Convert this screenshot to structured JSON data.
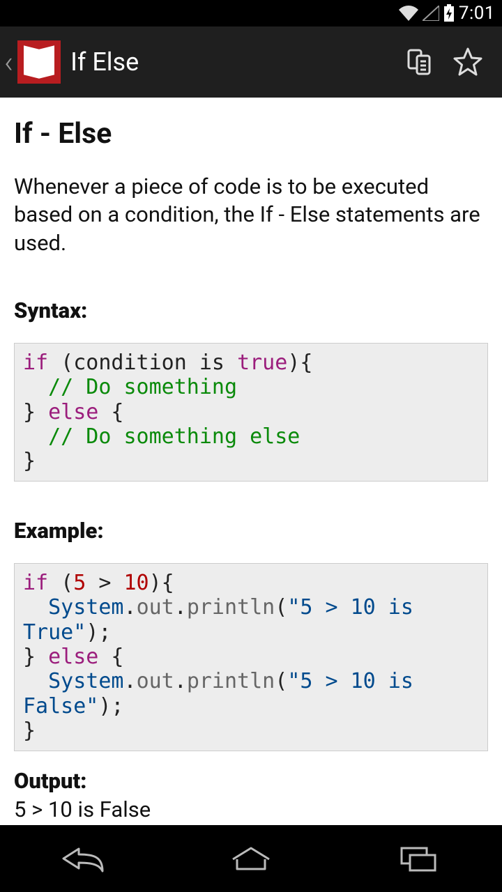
{
  "status": {
    "time": "7:01"
  },
  "appbar": {
    "title": "If Else"
  },
  "content": {
    "heading": "If - Else",
    "description": "Whenever a piece of code is to be executed based on a condition, the If - Else statements are used.",
    "syntax_label": "Syntax:",
    "example_label": "Example:",
    "output_label": "Output:",
    "output_text": "5 > 10 is False"
  },
  "code": {
    "syntax": {
      "tokens": [
        {
          "t": "kw",
          "v": "if"
        },
        {
          "t": "",
          "v": " (condition is "
        },
        {
          "t": "kw",
          "v": "true"
        },
        {
          "t": "",
          "v": "){\n  "
        },
        {
          "t": "cm",
          "v": "// Do something"
        },
        {
          "t": "",
          "v": "\n} "
        },
        {
          "t": "kw",
          "v": "else"
        },
        {
          "t": "",
          "v": " {\n  "
        },
        {
          "t": "cm",
          "v": "// Do something else"
        },
        {
          "t": "",
          "v": "\n}"
        }
      ]
    },
    "example": {
      "tokens": [
        {
          "t": "kw",
          "v": "if"
        },
        {
          "t": "",
          "v": " ("
        },
        {
          "t": "num",
          "v": "5"
        },
        {
          "t": "",
          "v": " > "
        },
        {
          "t": "num",
          "v": "10"
        },
        {
          "t": "",
          "v": "){\n  "
        },
        {
          "t": "cls",
          "v": "System"
        },
        {
          "t": "",
          "v": "."
        },
        {
          "t": "mth",
          "v": "out"
        },
        {
          "t": "",
          "v": "."
        },
        {
          "t": "mth",
          "v": "println"
        },
        {
          "t": "",
          "v": "("
        },
        {
          "t": "str",
          "v": "\"5 > 10 is True\""
        },
        {
          "t": "",
          "v": ");\n} "
        },
        {
          "t": "kw",
          "v": "else"
        },
        {
          "t": "",
          "v": " {\n  "
        },
        {
          "t": "cls",
          "v": "System"
        },
        {
          "t": "",
          "v": "."
        },
        {
          "t": "mth",
          "v": "out"
        },
        {
          "t": "",
          "v": "."
        },
        {
          "t": "mth",
          "v": "println"
        },
        {
          "t": "",
          "v": "("
        },
        {
          "t": "str",
          "v": "\"5 > 10 is False\""
        },
        {
          "t": "",
          "v": ");\n}"
        }
      ]
    }
  },
  "colors": {
    "accent": "#b81d20"
  }
}
